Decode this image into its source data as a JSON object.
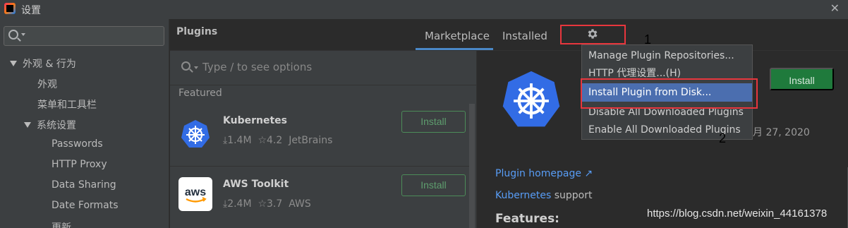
{
  "window": {
    "title": "设置"
  },
  "sidebar": {
    "search_placeholder": "",
    "items": [
      {
        "label": "外观 & 行为",
        "expanded": true
      },
      {
        "label": "外观"
      },
      {
        "label": "菜单和工具栏"
      },
      {
        "label": "系统设置",
        "expanded": true
      },
      {
        "label": "Passwords"
      },
      {
        "label": "HTTP Proxy"
      },
      {
        "label": "Data Sharing"
      },
      {
        "label": "Date Formats"
      },
      {
        "label": "更新"
      }
    ]
  },
  "header": {
    "title": "Plugins",
    "tabs": [
      {
        "label": "Marketplace",
        "active": true
      },
      {
        "label": "Installed",
        "active": false
      }
    ],
    "gear_icon": "gear-icon"
  },
  "list": {
    "search_placeholder": "Type / to see options",
    "section": "Featured",
    "plugins": [
      {
        "name": "Kubernetes",
        "downloads": "1.4M",
        "rating": "4.2",
        "vendor": "JetBrains",
        "button": "Install",
        "icon": "kubernetes-icon"
      },
      {
        "name": "AWS Toolkit",
        "downloads": "2.4M",
        "rating": "3.7",
        "vendor": "AWS",
        "button": "Install",
        "icon": "aws-icon"
      }
    ]
  },
  "detail": {
    "install_button": "Install",
    "date": "月 27, 2020",
    "homepage_link": "Plugin homepage ↗",
    "support_link": "Kubernetes",
    "support_text": " support",
    "features_heading": "Features:"
  },
  "gear_menu": {
    "items": [
      {
        "label": "Manage Plugin Repositories..."
      },
      {
        "label": "HTTP 代理设置...(H)"
      },
      {
        "label": "Install Plugin from Disk...",
        "selected": true
      },
      {
        "label": "Disable All Downloaded Plugins"
      },
      {
        "label": "Enable All Downloaded Plugins"
      }
    ]
  },
  "annotations": {
    "one": "1",
    "two": "2"
  },
  "watermark": "https://blog.csdn.net/weixin_44161378",
  "colors": {
    "accent": "#4a88c7",
    "install_green": "#1f7a3c",
    "selection": "#4b6eaf",
    "annotation_red": "#e8363d"
  }
}
